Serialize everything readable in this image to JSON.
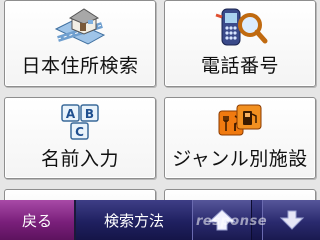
{
  "menu": {
    "address_search": "日本住所検索",
    "phone_number": "電話番号",
    "name_entry": "名前入力",
    "genre_facility": "ジャンル別施設"
  },
  "icons": {
    "address": "house-crossroad-icon",
    "phone": "phone-magnifier-icon",
    "name": "abc-blocks-icon",
    "genre": "restaurant-fuel-icon"
  },
  "abc_letters": [
    "A",
    "B",
    "C"
  ],
  "bottom_bar": {
    "back": "戻る",
    "search_method": "検索方法",
    "up": "scroll-up-icon",
    "down": "scroll-down-icon"
  },
  "watermark": "response"
}
